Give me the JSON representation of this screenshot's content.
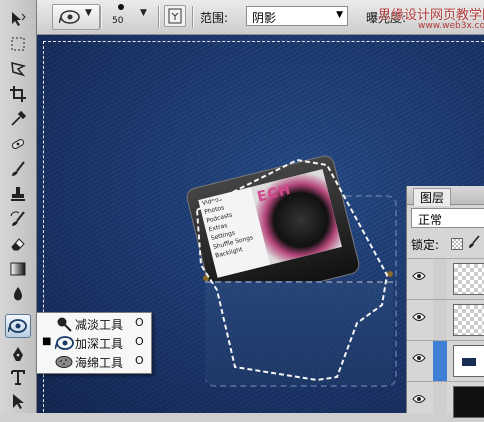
{
  "options_bar": {
    "brush_size": "50",
    "range_label": "范围:",
    "range_value": "阴影",
    "exposure_label": "曝光度:",
    "watermark": "思缘设计网页教学网",
    "watermark_url": "www.web3x.com"
  },
  "toolbox": {
    "tools": [
      "move-tool",
      "marquee-tool",
      "lasso-tool",
      "crop-tool",
      "eyedropper-tool",
      "healing-tool",
      "brush-tool",
      "stamp-tool",
      "history-brush-tool",
      "eraser-tool",
      "gradient-tool",
      "blur-tool",
      "dodge-burn-tool",
      "pen-tool",
      "type-tool",
      "path-select-tool"
    ]
  },
  "canvas": {
    "ipod_menu": [
      "Videos",
      "Photos",
      "Podcasts",
      "Extras",
      "Settings",
      "Shuffle Songs",
      "Backlight"
    ],
    "ipod_title": "ECH"
  },
  "flyout": {
    "items": [
      {
        "label": "减淡工具",
        "shortcut": "O",
        "selected": false,
        "icon": "dodge-icon"
      },
      {
        "label": "加深工具",
        "shortcut": "O",
        "selected": true,
        "icon": "burn-icon"
      },
      {
        "label": "海绵工具",
        "shortcut": "O",
        "selected": false,
        "icon": "sponge-icon"
      }
    ],
    "bullet": "■"
  },
  "layers_panel": {
    "tab_label": "图层",
    "blend_mode": "正常",
    "lock_label": "锁定:",
    "selected_color": "#3d80d6"
  }
}
